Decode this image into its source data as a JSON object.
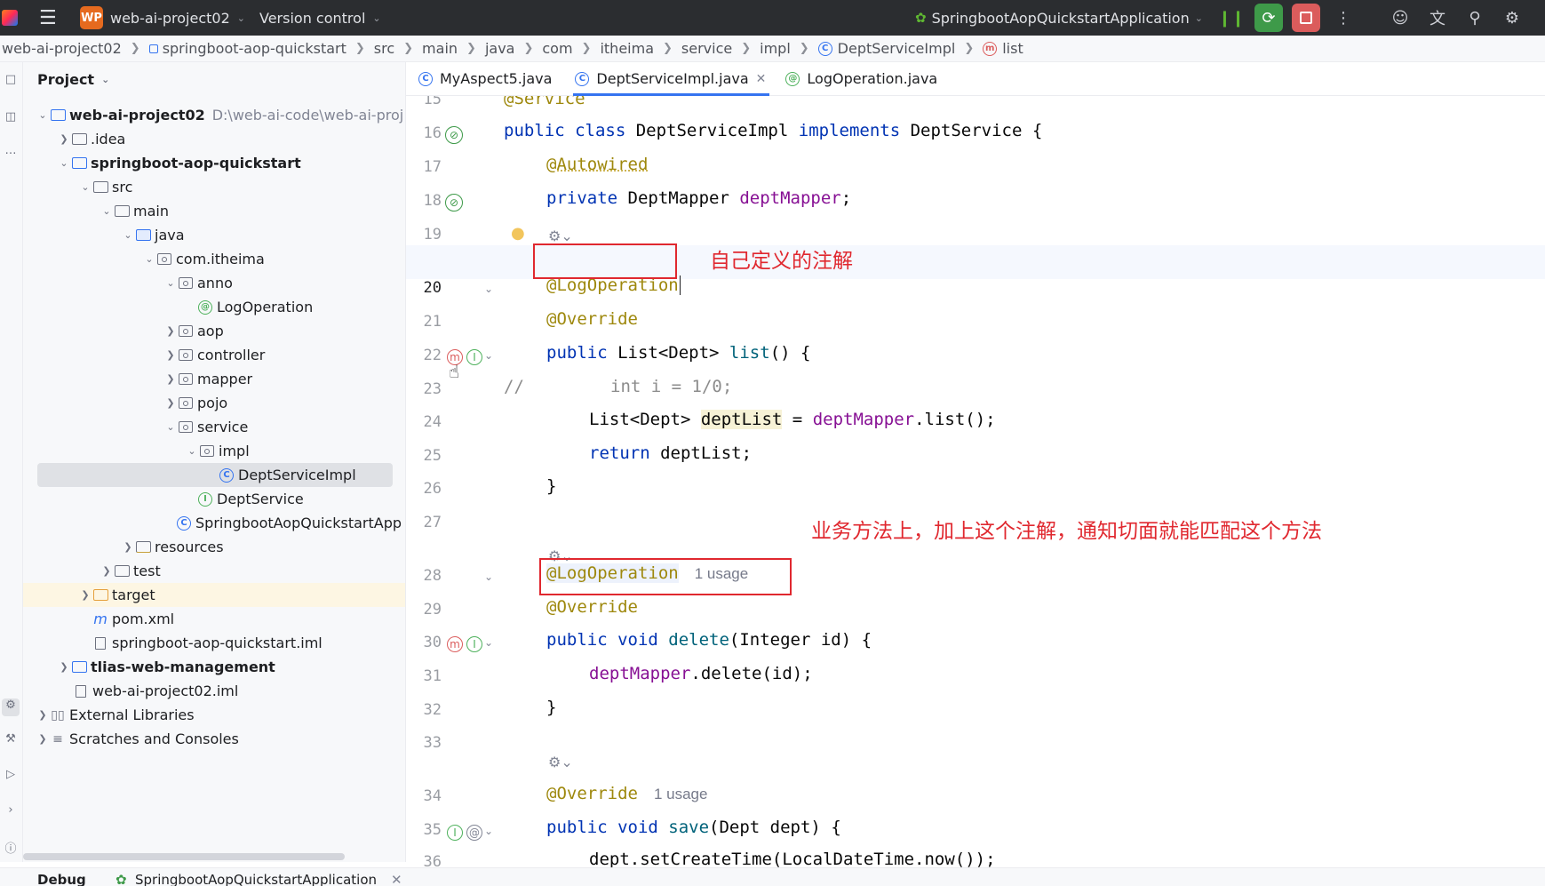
{
  "titlebar": {
    "project_badge": "WP",
    "project_name": "web-ai-project02",
    "vcs": "Version control",
    "run_config": "SpringbootAopQuickstartApplication"
  },
  "breadcrumb": [
    "web-ai-project02",
    "springboot-aop-quickstart",
    "src",
    "main",
    "java",
    "com",
    "itheima",
    "service",
    "impl",
    "DeptServiceImpl",
    "list"
  ],
  "project_panel": {
    "title": "Project",
    "root_name": "web-ai-project02",
    "root_path": "D:\\web-ai-code\\web-ai-proj",
    "items": [
      {
        "label": "web-ai-project02"
      },
      {
        "label": ".idea"
      },
      {
        "label": "springboot-aop-quickstart"
      },
      {
        "label": "src"
      },
      {
        "label": "main"
      },
      {
        "label": "java"
      },
      {
        "label": "com.itheima"
      },
      {
        "label": "anno"
      },
      {
        "label": "LogOperation"
      },
      {
        "label": "aop"
      },
      {
        "label": "controller"
      },
      {
        "label": "mapper"
      },
      {
        "label": "pojo"
      },
      {
        "label": "service"
      },
      {
        "label": "impl"
      },
      {
        "label": "DeptServiceImpl"
      },
      {
        "label": "DeptService"
      },
      {
        "label": "SpringbootAopQuickstartApp"
      },
      {
        "label": "resources"
      },
      {
        "label": "test"
      },
      {
        "label": "target"
      },
      {
        "label": "pom.xml"
      },
      {
        "label": "springboot-aop-quickstart.iml"
      },
      {
        "label": "tlias-web-management"
      },
      {
        "label": "web-ai-project02.iml"
      },
      {
        "label": "External Libraries"
      },
      {
        "label": "Scratches and Consoles"
      }
    ]
  },
  "tabs": [
    {
      "label": "MyAspect5.java"
    },
    {
      "label": "DeptServiceImpl.java"
    },
    {
      "label": "LogOperation.java"
    }
  ],
  "line_numbers": [
    "15",
    "16",
    "17",
    "18",
    "19",
    "20",
    "21",
    "22",
    "23",
    "24",
    "25",
    "26",
    "27",
    "28",
    "29",
    "30",
    "31",
    "32",
    "33",
    "34",
    "35",
    "36"
  ],
  "code": {
    "l15": "@Service",
    "l16_kw": "public class",
    "l16_name": " DeptServiceImpl ",
    "l16_kw2": "implements",
    "l16_rest": " DeptService {",
    "l17": "@Autowired",
    "l18_kw": "private",
    "l18_type": " DeptMapper ",
    "l18_field": "deptMapper",
    "l18_end": ";",
    "l20": "@LogOperation",
    "l21": "@Override",
    "l22_kw": "public",
    "l22_type": " List<Dept> ",
    "l22_fn": "list",
    "l22_end": "() {",
    "l23_cmt": "//",
    "l23_code": "int i = 1/0;",
    "l24_type": "List<Dept> ",
    "l24_var": "deptList",
    "l24_eq": " = ",
    "l24_field": "deptMapper",
    "l24_end": ".list();",
    "l25_kw": "return",
    "l25_end": " deptList;",
    "l26": "}",
    "l28": "@LogOperation",
    "l28_hint": "1 usage",
    "l29": "@Override",
    "l30_kw": "public void",
    "l30_fn": " delete",
    "l30_end": "(Integer id) {",
    "l31_field": "deptMapper",
    "l31_end": ".delete(id);",
    "l32": "}",
    "l34": "@Override",
    "l34_hint": "1 usage",
    "l35_kw": "public void",
    "l35_fn": " save",
    "l35_end": "(Dept dept) {",
    "l36": "dept.setCreateTime(LocalDateTime.now());"
  },
  "annotations": {
    "note1": "自己定义的注解",
    "note2": "业务方法上，加上这个注解，通知切面就能匹配这个方法"
  },
  "bottom": {
    "debug": "Debug",
    "run_config": "SpringbootAopQuickstartApplication"
  },
  "colors": {
    "accent": "#3574f0",
    "annotation_red": "#e0282f",
    "keyword": "#0033b3",
    "annotation_code": "#9e880d",
    "field": "#871094"
  }
}
